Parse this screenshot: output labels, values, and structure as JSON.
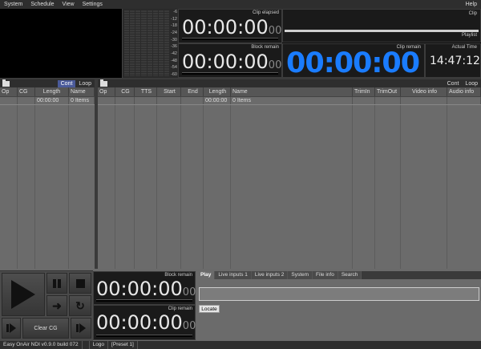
{
  "menu": [
    "System",
    "Schedule",
    "View",
    "Settings"
  ],
  "help_label": "Help",
  "vu_scale": [
    "-6",
    "-12",
    "-18",
    "-24",
    "-30",
    "-36",
    "-42",
    "-48",
    "-54",
    "-60"
  ],
  "timers": {
    "clip_elapsed": {
      "label": "Clip elapsed",
      "time": "00:00:00",
      "frames": "00"
    },
    "block_remain": {
      "label": "Block remain",
      "time": "00:00:00",
      "frames": "00"
    },
    "clip_remain": {
      "label": "Clip remain",
      "time": "00:00:00"
    },
    "actual_time": {
      "label": "Actual Time",
      "time": "14:47:12"
    }
  },
  "clip_box": {
    "label": "Clip",
    "playlist_label": "Playlist"
  },
  "left_panel": {
    "buttons": [
      {
        "label": "Cont",
        "active": true
      },
      {
        "label": "Loop",
        "active": false
      }
    ],
    "columns": [
      "Op",
      "CG",
      "Length",
      "Name"
    ],
    "summary": {
      "length": "00:00:00",
      "name": "0 Items"
    }
  },
  "right_panel": {
    "buttons": [
      {
        "label": "Cont",
        "active": false
      },
      {
        "label": "Loop",
        "active": false
      }
    ],
    "columns": [
      "Op",
      "CG",
      "TTS",
      "Start",
      "End",
      "Length",
      "Name",
      "TrimIn",
      "TrimOut",
      "Video info",
      "Audio info"
    ],
    "summary": {
      "length": "00:00:00",
      "name": "0 Items"
    }
  },
  "controls": {
    "clear_cg_label": "Clear CG",
    "icons": [
      "play-icon",
      "pause-icon",
      "stop-icon",
      "next-arrow-icon",
      "loop-icon",
      "skip-back-icon",
      "skip-forward-icon"
    ]
  },
  "bottom_timers": {
    "block_remain": {
      "label": "Block remain",
      "time": "00:00:00",
      "frames": "00"
    },
    "clip_remain": {
      "label": "Clip remain",
      "time": "00:00:00",
      "frames": "00"
    }
  },
  "tabs": [
    {
      "label": "Play",
      "active": true
    },
    {
      "label": "Live inputs 1",
      "active": false
    },
    {
      "label": "Live inputs 2",
      "active": false
    },
    {
      "label": "System",
      "active": false
    },
    {
      "label": "File info",
      "active": false
    },
    {
      "label": "Search",
      "active": false
    }
  ],
  "locate_label": "Locate",
  "status_bar": [
    "Easy OnAir NDI v0.9.0 build 072",
    "",
    "Logo",
    "[Preset 1]"
  ],
  "colors": {
    "accent_blue": "#1a7cff",
    "active_button": "#4a5a9a"
  }
}
